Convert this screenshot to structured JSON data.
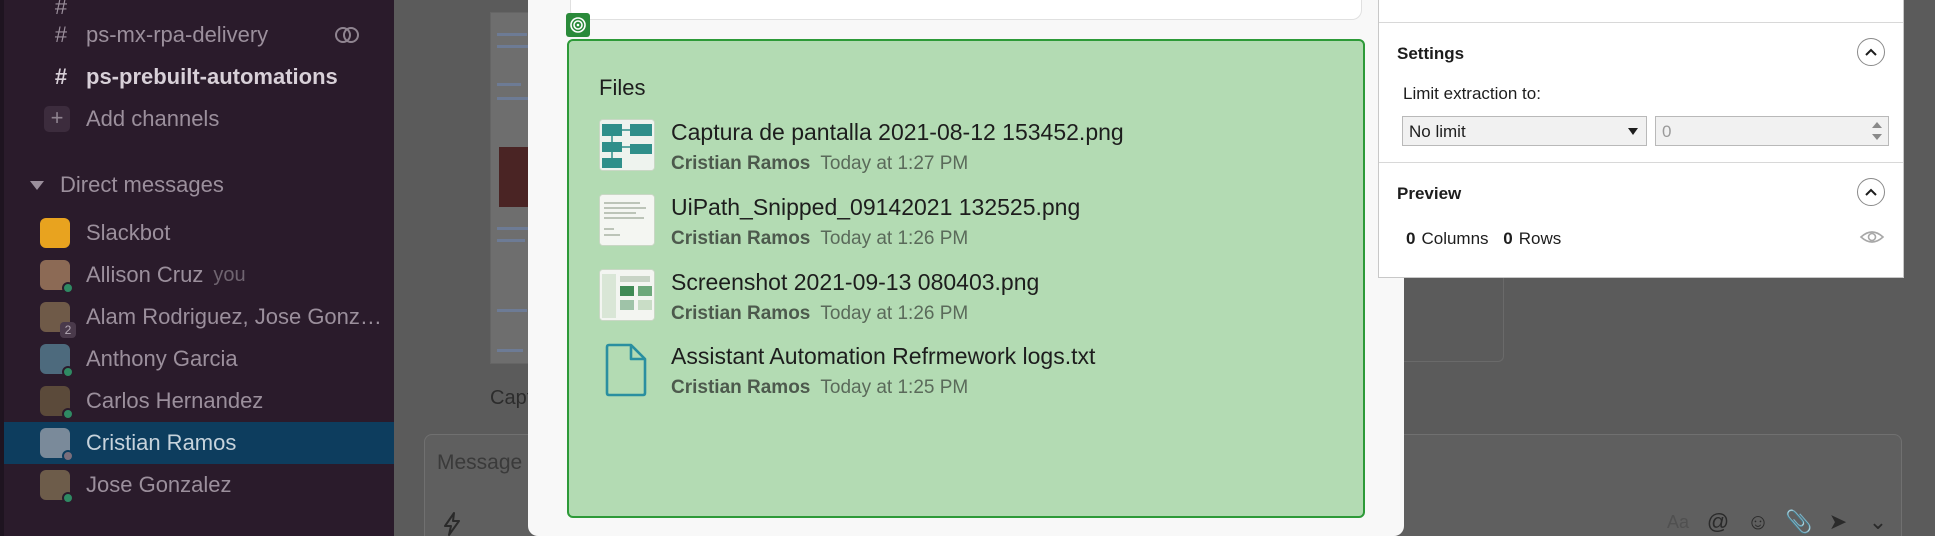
{
  "sidebar": {
    "channels": [
      {
        "name": "",
        "bold": false
      },
      {
        "name": "ps-mx-rpa-delivery",
        "bold": false,
        "has_rings": true
      },
      {
        "name": "ps-prebuilt-automations",
        "bold": true
      }
    ],
    "add_channels_label": "Add channels",
    "dm_section_label": "Direct messages",
    "direct_messages": [
      {
        "name": "Slackbot",
        "avatar_color": "#e8a31f",
        "status": "none"
      },
      {
        "name": "Allison Cruz",
        "suffix": "you",
        "avatar_color": "#8c6a55",
        "status": "online"
      },
      {
        "name": "Alam Rodriguez, Jose Gonz…",
        "avatar_color": "#6f5a48",
        "count": "2",
        "status": "count"
      },
      {
        "name": "Anthony Garcia",
        "avatar_color": "#4d6a7d",
        "status": "online"
      },
      {
        "name": "Carlos Hernandez",
        "avatar_color": "#5b4a3a",
        "status": "online"
      },
      {
        "name": "Cristian Ramos",
        "avatar_color": "#7a8a9a",
        "status": "away",
        "active": true
      },
      {
        "name": "Jose Gonzalez",
        "avatar_color": "#6d5c4a",
        "status": "online"
      }
    ]
  },
  "chat": {
    "caption_fragment": "Capt",
    "composer_placeholder": "Message",
    "composer_icons": [
      "Aa",
      "@",
      "☺",
      "📎",
      "➤",
      "⌄"
    ]
  },
  "files_panel": {
    "title": "Files",
    "files": [
      {
        "name": "Captura de pantalla 2021-08-12 153452.png",
        "author": "Cristian Ramos",
        "time": "Today at 1:27 PM",
        "thumb": "diagram"
      },
      {
        "name": "UiPath_Snipped_09142021 132525.png",
        "author": "Cristian Ramos",
        "time": "Today at 1:26 PM",
        "thumb": "text"
      },
      {
        "name": "Screenshot 2021-09-13 080403.png",
        "author": "Cristian Ramos",
        "time": "Today at 1:26 PM",
        "thumb": "screen"
      },
      {
        "name": "Assistant Automation Refrmework logs.txt",
        "author": "Cristian Ramos",
        "time": "Today at 1:25 PM",
        "thumb": "doc"
      }
    ]
  },
  "properties": {
    "settings_title": "Settings",
    "limit_label": "Limit extraction to:",
    "limit_value": "No limit",
    "limit_number": "0",
    "preview_title": "Preview",
    "columns_count": "0",
    "columns_label": "Columns",
    "rows_count": "0",
    "rows_label": "Rows"
  },
  "colors": {
    "sidebar_bg": "#2a1b2b",
    "active_row": "#0d3d5e",
    "highlight_fill": "#b3dbb3",
    "highlight_border": "#2d9a38",
    "doc_icon": "#2a8fa0"
  }
}
